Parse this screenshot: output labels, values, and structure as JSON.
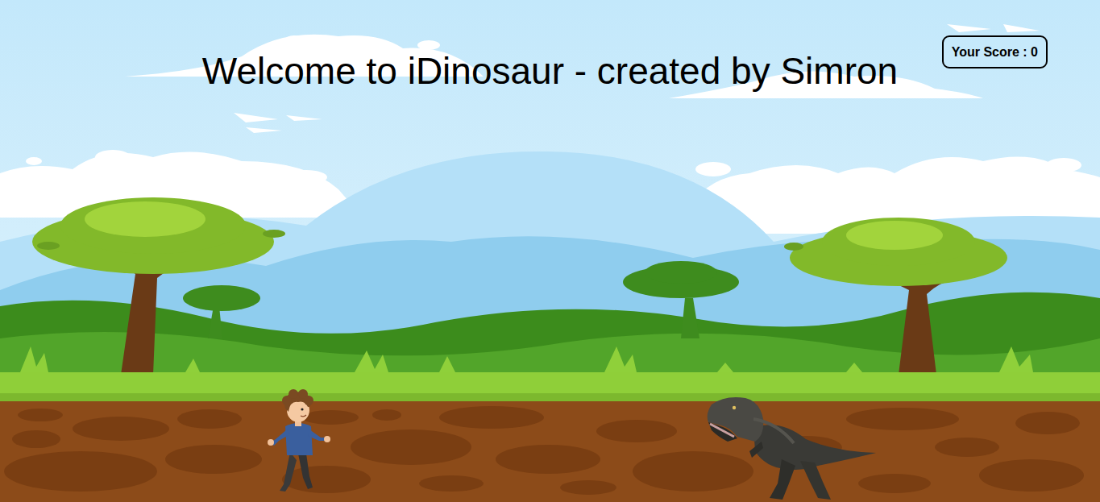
{
  "title": "Welcome to iDinosaur - created by Simron",
  "score": {
    "text": "Your Score : 0"
  }
}
